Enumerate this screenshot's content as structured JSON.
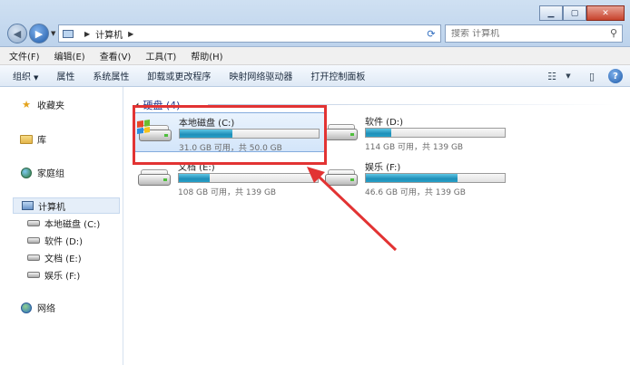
{
  "address": {
    "path": [
      "计算机"
    ]
  },
  "search": {
    "placeholder": "搜索 计算机"
  },
  "menu": [
    "文件(F)",
    "编辑(E)",
    "查看(V)",
    "工具(T)",
    "帮助(H)"
  ],
  "toolbar": [
    "组织",
    "属性",
    "系统属性",
    "卸载或更改程序",
    "映射网络驱动器",
    "打开控制面板"
  ],
  "sidebar": {
    "favorites": "收藏夹",
    "libraries": "库",
    "homegroup": "家庭组",
    "computer": "计算机",
    "drives": [
      "本地磁盘 (C:)",
      "软件 (D:)",
      "文档 (E:)",
      "娱乐 (F:)"
    ],
    "network": "网络"
  },
  "group": {
    "title": "硬盘 (4)"
  },
  "drives": [
    {
      "name": "本地磁盘 (C:)",
      "info": "31.0 GB 可用，共 50.0 GB",
      "used_fraction": 0.38,
      "system": true
    },
    {
      "name": "软件 (D:)",
      "info": "114 GB 可用，共 139 GB",
      "used_fraction": 0.18,
      "system": false
    },
    {
      "name": "文档 (E:)",
      "info": "108 GB 可用，共 139 GB",
      "used_fraction": 0.22,
      "system": false
    },
    {
      "name": "娱乐 (F:)",
      "info": "46.6 GB 可用，共 139 GB",
      "used_fraction": 0.66,
      "system": false
    }
  ],
  "colors": {
    "annotation": "#e23333",
    "bar_fill": "#1f8fb8",
    "group_title": "#1e3287"
  }
}
